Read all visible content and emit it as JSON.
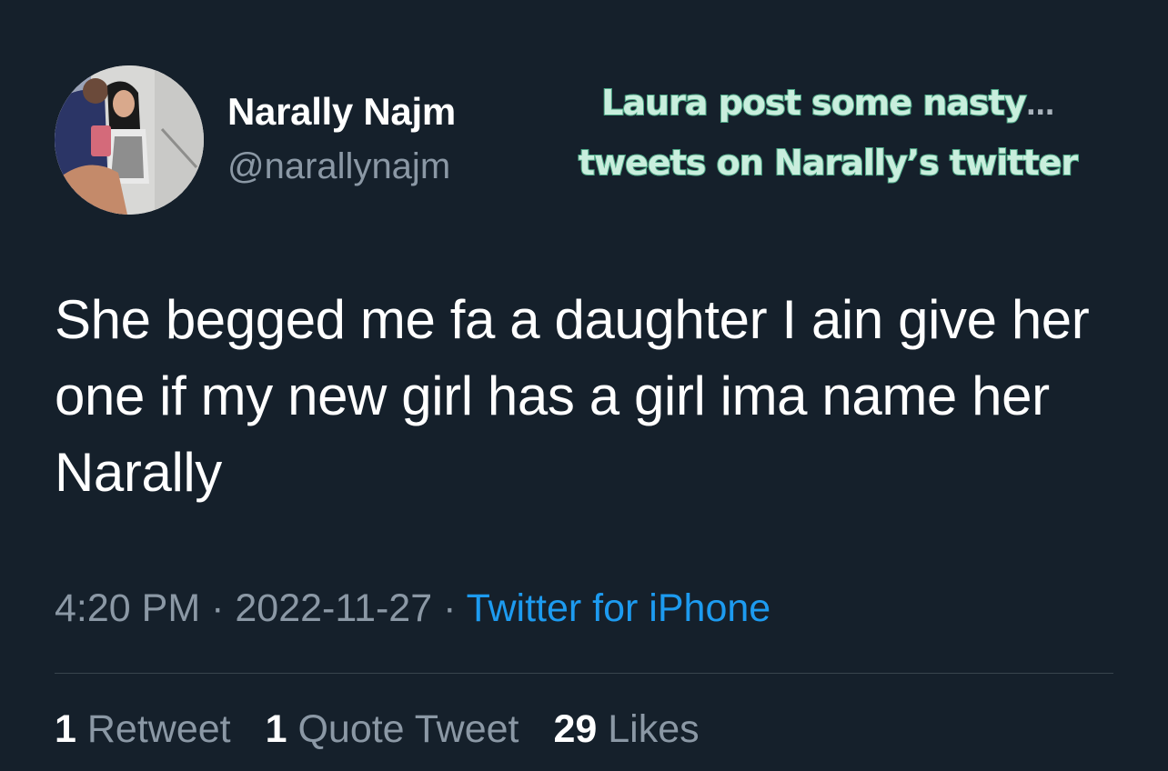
{
  "author": {
    "display_name": "Narally Najm",
    "handle": "@narallynajm"
  },
  "overlay_caption": {
    "line1": "Laura post some nasty",
    "ellipsis": "...",
    "line2": "tweets on Narally’s twitter"
  },
  "tweet": {
    "text": "She begged me fa a daughter I ain give her one if my new girl has a girl ima name her Narally",
    "time": "4:20 PM",
    "separator": "·",
    "date": "2022-11-27",
    "source": "Twitter for iPhone"
  },
  "stats": {
    "retweets_count": "1",
    "retweets_label": "Retweet",
    "quotes_count": "1",
    "quotes_label": "Quote Tweet",
    "likes_count": "29",
    "likes_label": "Likes"
  },
  "colors": {
    "background": "#15202b",
    "primary_text": "#ffffff",
    "secondary_text": "#8b98a5",
    "link": "#1d9bf0",
    "overlay_text": "#c9eedd",
    "overlay_outline": "#4fae8b"
  }
}
